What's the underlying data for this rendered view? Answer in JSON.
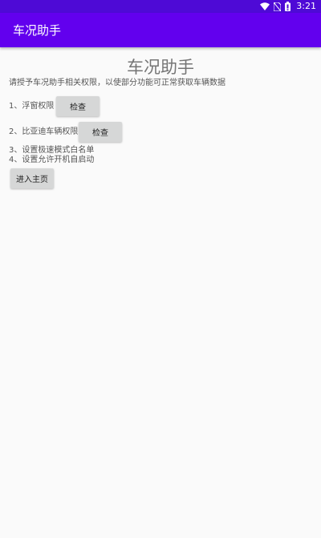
{
  "status_bar": {
    "time": "3:21",
    "icons": [
      "wifi-icon",
      "no-sim-icon",
      "battery-icon"
    ]
  },
  "app_bar": {
    "title": "车况助手"
  },
  "main": {
    "title": "车况助手",
    "intro": "请授予车况助手相关权限，以使部分功能可正常获取车辆数据",
    "items": [
      {
        "label": "1、浮窗权限",
        "button": "检查"
      },
      {
        "label": "2、比亚迪车辆权限",
        "button": "检查"
      },
      {
        "label": "3、设置极速模式白名单"
      },
      {
        "label": "4、设置允许开机自启动"
      }
    ],
    "enter_button": "进入主页"
  },
  "colors": {
    "status_bar": "#4e0ad6",
    "app_bar": "#6200ee",
    "background": "#fafafa",
    "button": "#d6d7d7"
  }
}
